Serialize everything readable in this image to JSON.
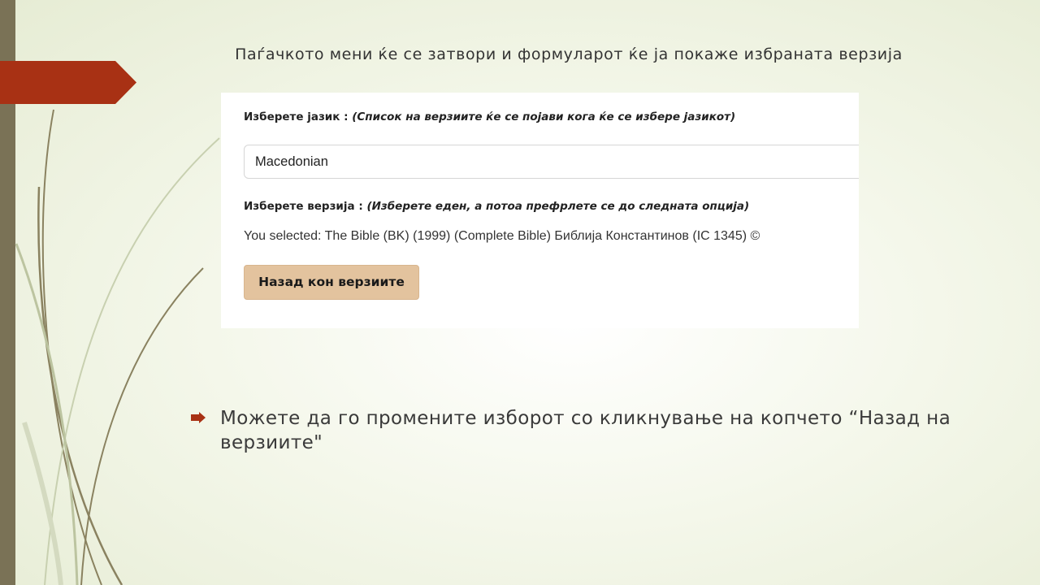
{
  "slide": {
    "title": "Паѓачкото мени ќе се затвори и формуларот ќе ја покаже избраната верзија",
    "bullet_text": "Можете да го промените изборот со кликнување на копчето “Назад на верзиите\"",
    "accent_color": "#a83114",
    "sidebar_color": "#7a7256"
  },
  "form": {
    "language_label": "Изберете јазик :",
    "language_hint": "(Список на верзиите ќе се појави кога ќе се избере јазикот)",
    "language_value": "Macedonian",
    "version_label": "Изберете верзија :",
    "version_hint": "(Изберете еден, а потоа префрлете се до следната опција)",
    "selected_text": "You selected: The Bible (BK) (1999) (Complete Bible) Библија Константинов (IC 1345) ©",
    "back_button_label": "Назад кон верзиите",
    "button_color": "#e3c39e"
  }
}
